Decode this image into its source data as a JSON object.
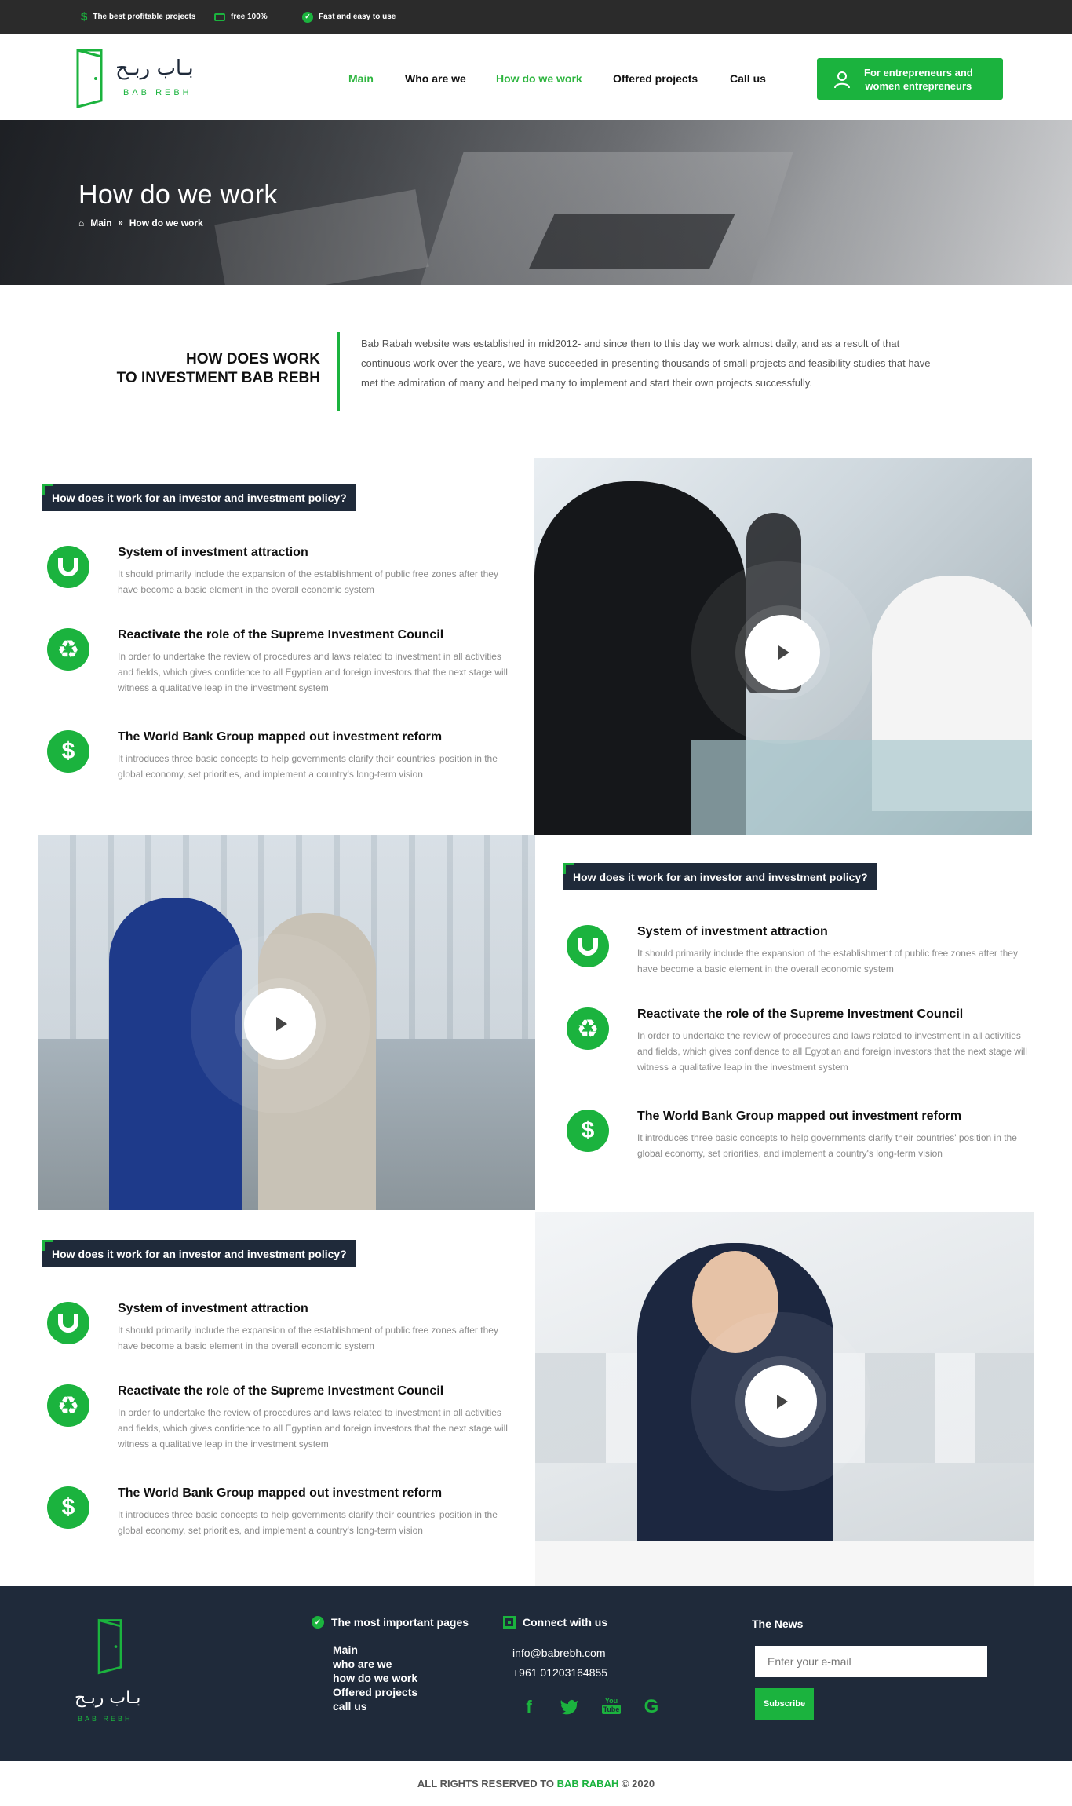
{
  "topbar": {
    "items": [
      {
        "icon": "dollar-icon",
        "label": "The best profitable projects"
      },
      {
        "icon": "money-icon",
        "label": "free 100%"
      },
      {
        "icon": "check-circle-icon",
        "label": "Fast and easy to use"
      }
    ]
  },
  "logo": {
    "arabic": "بـاب ربـح",
    "latin": "BAB REBH"
  },
  "nav": {
    "items": [
      "Main",
      "Who are we",
      "How do we work",
      "Offered projects",
      "Call us"
    ],
    "active": "How do we work"
  },
  "cta": {
    "icon": "user-icon",
    "label_line1": "For entrepreneurs and",
    "label_line2": "women entrepreneurs"
  },
  "hero": {
    "title": "How do we work",
    "breadcrumb": [
      "Main",
      "How do we work"
    ]
  },
  "intro": {
    "title_line1": "HOW DOES WORK",
    "title_line2": "TO INVESTMENT BAB REBH",
    "text": "Bab Rabah website was established in mid2012- and since then to this day we work almost daily, and as a result of that continuous work over the years, we have succeeded in presenting thousands of small projects and feasibility studies that have met the admiration of many and helped many to implement and start their own projects successfully."
  },
  "sections": [
    {
      "label": "How does it work for an investor and investment policy?",
      "features": [
        {
          "icon": "magnet-icon",
          "title": "System of investment attraction",
          "desc": "It should primarily include the expansion of the establishment of public free zones after they have become a basic element in the overall economic system"
        },
        {
          "icon": "recycle-icon",
          "title": "Reactivate the role of the Supreme Investment Council",
          "desc": "In order to undertake the review of procedures and laws related to investment in all activities and fields, which gives confidence to all Egyptian and foreign investors that the next stage will witness a qualitative leap in the investment system"
        },
        {
          "icon": "dollar-icon",
          "title": "The World Bank Group mapped out investment reform",
          "desc": "It introduces three basic concepts to help governments clarify their countries' position in the global economy, set priorities, and implement a country's long-term vision"
        }
      ]
    },
    {
      "label": "How does it work for an investor and investment policy?",
      "features": [
        {
          "icon": "magnet-icon",
          "title": "System of investment attraction",
          "desc": "It should primarily include the expansion of the establishment of public free zones after they have become a basic element in the overall economic system"
        },
        {
          "icon": "recycle-icon",
          "title": "Reactivate the role of the Supreme Investment Council",
          "desc": "In order to undertake the review of procedures and laws related to investment in all activities and fields, which gives confidence to all Egyptian and foreign investors that the next stage will witness a qualitative leap in the investment system"
        },
        {
          "icon": "dollar-icon",
          "title": "The World Bank Group mapped out investment reform",
          "desc": "It introduces three basic concepts to help governments clarify their countries' position in the global economy, set priorities, and implement a country's long-term vision"
        }
      ]
    },
    {
      "label": "How does it work for an investor and investment policy?",
      "features": [
        {
          "icon": "magnet-icon",
          "title": "System of investment attraction",
          "desc": "It should primarily include the expansion of the establishment of public free zones after they have become a basic element in the overall economic system"
        },
        {
          "icon": "recycle-icon",
          "title": "Reactivate the role of the Supreme Investment Council",
          "desc": "In order to undertake the review of procedures and laws related to investment in all activities and fields, which gives confidence to all Egyptian and foreign investors that the next stage will witness a qualitative leap in the investment system"
        },
        {
          "icon": "dollar-icon",
          "title": "The World Bank Group mapped out investment reform",
          "desc": "It introduces three basic concepts to help governments clarify their countries' position in the global economy, set priorities, and implement a country's long-term vision"
        }
      ]
    }
  ],
  "footer": {
    "pages_title": "The most important pages",
    "pages": [
      "Main",
      "who are we",
      "how do we work",
      "Offered projects",
      "call us"
    ],
    "connect_title": "Connect with us",
    "email": "info@babrebh.com",
    "phone": "+961 01203164855",
    "social": [
      "facebook-icon",
      "twitter-icon",
      "youtube-icon",
      "google-icon"
    ],
    "news_title": "The News",
    "email_placeholder": "Enter your e-mail",
    "subscribe_label": "Subscribe",
    "copyright_prefix": "ALL RIGHTS RESERVED TO ",
    "copyright_brand": "BAB RABAH",
    "copyright_suffix": " © 2020"
  },
  "colors": {
    "accent": "#1bb33e",
    "dark": "#1f2a3a",
    "topbar": "#2b2b2b"
  }
}
